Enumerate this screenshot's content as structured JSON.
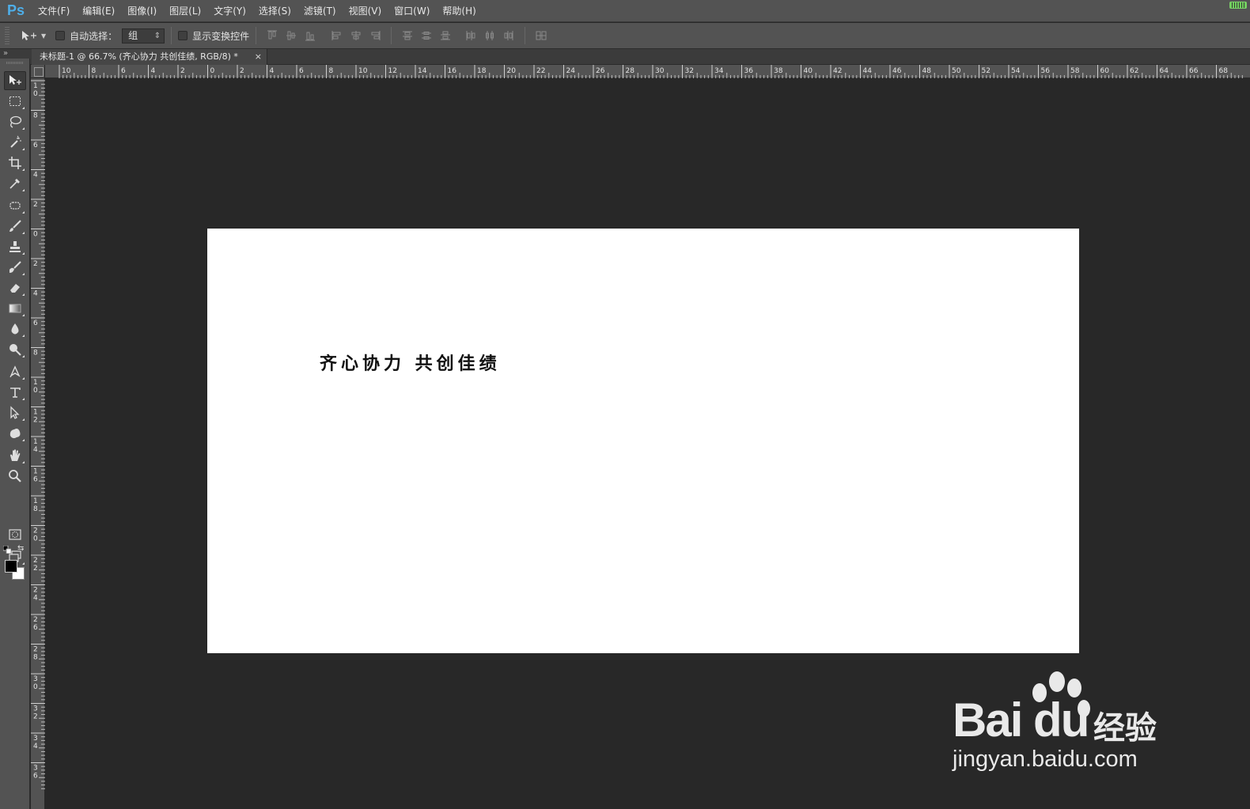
{
  "app": {
    "logo": "Ps"
  },
  "menu": [
    {
      "label": "文件(F)"
    },
    {
      "label": "编辑(E)"
    },
    {
      "label": "图像(I)"
    },
    {
      "label": "图层(L)"
    },
    {
      "label": "文字(Y)"
    },
    {
      "label": "选择(S)"
    },
    {
      "label": "滤镜(T)"
    },
    {
      "label": "视图(V)"
    },
    {
      "label": "窗口(W)"
    },
    {
      "label": "帮助(H)"
    }
  ],
  "options": {
    "auto_select_label": "自动选择：",
    "auto_select_value": "组",
    "show_transform_label": "显示变换控件"
  },
  "document": {
    "tab_title": "未标题-1 @ 66.7% (齐心协力 共创佳绩, RGB/8) *",
    "close_glyph": "×",
    "canvas_text": "齐心协力 共创佳绩"
  },
  "ruler_h": [
    "10",
    "8",
    "6",
    "4",
    "2",
    "0",
    "2",
    "4",
    "6",
    "8",
    "10",
    "12",
    "14",
    "16",
    "18",
    "20",
    "22",
    "24",
    "26",
    "28",
    "30",
    "32",
    "34",
    "36",
    "38",
    "40",
    "42",
    "44",
    "46",
    "48",
    "50",
    "52",
    "54",
    "56",
    "58",
    "60",
    "62",
    "64",
    "66",
    "68"
  ],
  "ruler_v": [
    "10",
    "8",
    "6",
    "4",
    "2",
    "0",
    "2",
    "4",
    "6",
    "8",
    "10",
    "12",
    "14",
    "16",
    "18",
    "20",
    "22",
    "24",
    "26",
    "28",
    "30",
    "32",
    "34",
    "36"
  ],
  "tools": [
    "move-tool",
    "marquee-tool",
    "lasso-tool",
    "magic-wand-tool",
    "crop-tool",
    "eyedropper-tool",
    "healing-tool",
    "brush-tool",
    "stamp-tool",
    "history-brush-tool",
    "eraser-tool",
    "gradient-tool",
    "blur-tool",
    "dodge-tool",
    "pen-tool",
    "type-tool",
    "path-select-tool",
    "shape-tool",
    "hand-tool",
    "zoom-tool"
  ],
  "colors": {
    "foreground": "#000000",
    "background": "#ffffff",
    "accent": "#4eaee8"
  },
  "watermark": {
    "brand": "Bai du",
    "cn": "经验",
    "url": "jingyan.baidu.com"
  }
}
